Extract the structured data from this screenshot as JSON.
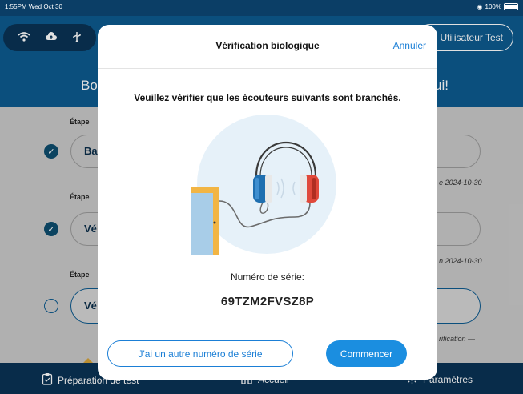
{
  "status_bar": {
    "time": "1:55PM  Wed Oct 30",
    "battery": "100%"
  },
  "header": {
    "user_button": "Utilisateur Test",
    "greeting_left": "Bo",
    "greeting_right": "ui!"
  },
  "background_list": {
    "stages": [
      "Étape",
      "Étape",
      "Étape"
    ],
    "rows": [
      {
        "text": "Ba",
        "date": "e 2024-10-30",
        "status": "done"
      },
      {
        "text": "Vé",
        "date": "n 2024-10-30",
        "status": "done"
      },
      {
        "text": "Vé",
        "date": "rification —",
        "status": "pending"
      }
    ]
  },
  "modal": {
    "title": "Vérification biologique",
    "cancel_label": "Annuler",
    "instruction": "Veuillez vérifier que les écouteurs suivants sont branchés.",
    "serial_label": "Numéro de série:",
    "serial_value": "69TZM2FVSZ8P",
    "other_serial_button": "J'ai un autre numéro de série",
    "start_button": "Commencer"
  },
  "bottom_nav": {
    "items": [
      {
        "label": "Préparation de test",
        "icon": "clipboard-icon"
      },
      {
        "label": "Accueil",
        "icon": "home-icon"
      },
      {
        "label": "Paramètres",
        "icon": "gear-icon"
      }
    ]
  },
  "colors": {
    "primary": "#1b8ee0",
    "header_blue": "#0d5a8f",
    "nav_dark": "#0a3355",
    "headphone_left": "#1f6fb0",
    "headphone_right": "#e0483a"
  }
}
